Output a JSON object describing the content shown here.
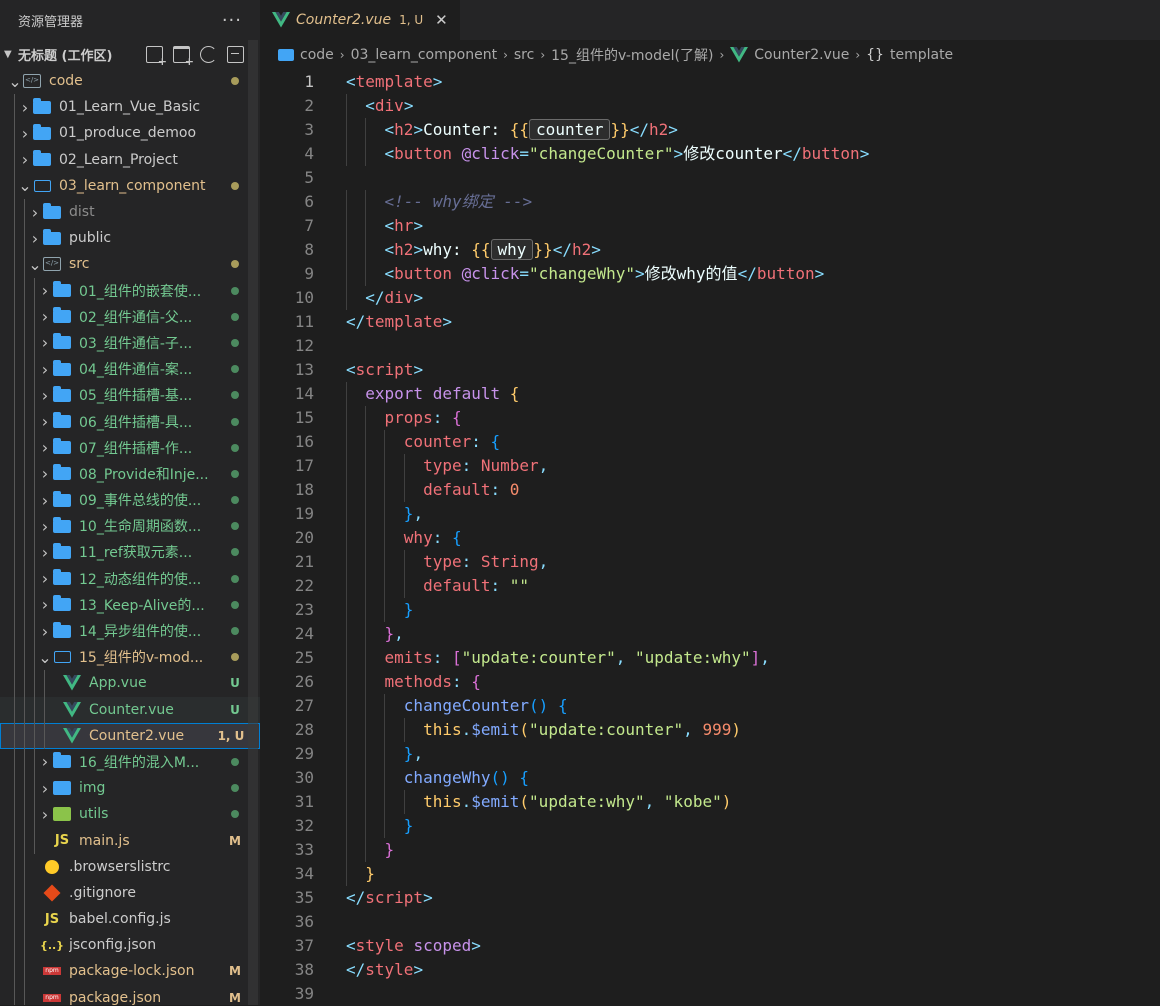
{
  "sidebar": {
    "title": "资源管理器",
    "more": "···",
    "workspace": "无标题 (工作区)",
    "tree": [
      {
        "depth": 0,
        "chev": "down",
        "icon": "folder-src",
        "label": "code",
        "color": "#e2c08d",
        "dot": "#a89c5b"
      },
      {
        "depth": 1,
        "chev": "right",
        "icon": "folder",
        "label": "01_Learn_Vue_Basic",
        "color": "#cccccc"
      },
      {
        "depth": 1,
        "chev": "right",
        "icon": "folder",
        "label": "01_produce_demoo",
        "color": "#cccccc"
      },
      {
        "depth": 1,
        "chev": "right",
        "icon": "folder",
        "label": "02_Learn_Project",
        "color": "#cccccc"
      },
      {
        "depth": 1,
        "chev": "down",
        "icon": "folder-open",
        "label": "03_learn_component",
        "color": "#e2c08d",
        "dot": "#a89c5b"
      },
      {
        "depth": 2,
        "chev": "right",
        "icon": "folder",
        "label": "dist",
        "color": "#8c8c8c"
      },
      {
        "depth": 2,
        "chev": "right",
        "icon": "folder",
        "label": "public",
        "color": "#cccccc"
      },
      {
        "depth": 2,
        "chev": "down",
        "icon": "folder-src",
        "label": "src",
        "color": "#e2c08d",
        "dot": "#a89c5b"
      },
      {
        "depth": 3,
        "chev": "right",
        "icon": "folder",
        "label": "01_组件的嵌套使...",
        "color": "#73c991",
        "dot": "#4c8a5f"
      },
      {
        "depth": 3,
        "chev": "right",
        "icon": "folder",
        "label": "02_组件通信-父...",
        "color": "#73c991",
        "dot": "#4c8a5f"
      },
      {
        "depth": 3,
        "chev": "right",
        "icon": "folder",
        "label": "03_组件通信-子...",
        "color": "#73c991",
        "dot": "#4c8a5f"
      },
      {
        "depth": 3,
        "chev": "right",
        "icon": "folder",
        "label": "04_组件通信-案...",
        "color": "#73c991",
        "dot": "#4c8a5f"
      },
      {
        "depth": 3,
        "chev": "right",
        "icon": "folder",
        "label": "05_组件插槽-基...",
        "color": "#73c991",
        "dot": "#4c8a5f"
      },
      {
        "depth": 3,
        "chev": "right",
        "icon": "folder",
        "label": "06_组件插槽-具...",
        "color": "#73c991",
        "dot": "#4c8a5f"
      },
      {
        "depth": 3,
        "chev": "right",
        "icon": "folder",
        "label": "07_组件插槽-作...",
        "color": "#73c991",
        "dot": "#4c8a5f"
      },
      {
        "depth": 3,
        "chev": "right",
        "icon": "folder",
        "label": "08_Provide和Inje...",
        "color": "#73c991",
        "dot": "#4c8a5f"
      },
      {
        "depth": 3,
        "chev": "right",
        "icon": "folder",
        "label": "09_事件总线的使...",
        "color": "#73c991",
        "dot": "#4c8a5f"
      },
      {
        "depth": 3,
        "chev": "right",
        "icon": "folder",
        "label": "10_生命周期函数...",
        "color": "#73c991",
        "dot": "#4c8a5f"
      },
      {
        "depth": 3,
        "chev": "right",
        "icon": "folder",
        "label": "11_ref获取元素...",
        "color": "#73c991",
        "dot": "#4c8a5f"
      },
      {
        "depth": 3,
        "chev": "right",
        "icon": "folder",
        "label": "12_动态组件的使...",
        "color": "#73c991",
        "dot": "#4c8a5f"
      },
      {
        "depth": 3,
        "chev": "right",
        "icon": "folder",
        "label": "13_Keep-Alive的...",
        "color": "#73c991",
        "dot": "#4c8a5f"
      },
      {
        "depth": 3,
        "chev": "right",
        "icon": "folder",
        "label": "14_异步组件的使...",
        "color": "#73c991",
        "dot": "#4c8a5f"
      },
      {
        "depth": 3,
        "chev": "down",
        "icon": "folder-open",
        "label": "15_组件的v-mod...",
        "color": "#e2c08d",
        "dot": "#a89c5b"
      },
      {
        "depth": 4,
        "chev": "",
        "icon": "vue",
        "label": "App.vue",
        "color": "#73c991",
        "badge": "U",
        "badgeColor": "#73c991"
      },
      {
        "depth": 4,
        "chev": "",
        "icon": "vue",
        "label": "Counter.vue",
        "color": "#73c991",
        "badge": "U",
        "badgeColor": "#73c991",
        "state": "hover"
      },
      {
        "depth": 4,
        "chev": "",
        "icon": "vue",
        "label": "Counter2.vue",
        "color": "#e2c08d",
        "badge": "1, U",
        "badgeColor": "#e2c08d",
        "state": "selected"
      },
      {
        "depth": 3,
        "chev": "right",
        "icon": "folder",
        "label": "16_组件的混入M...",
        "color": "#73c991",
        "dot": "#4c8a5f"
      },
      {
        "depth": 3,
        "chev": "right",
        "icon": "img",
        "label": "img",
        "color": "#73c991",
        "dot": "#4c8a5f"
      },
      {
        "depth": 3,
        "chev": "right",
        "icon": "utils",
        "label": "utils",
        "color": "#73c991",
        "dot": "#4c8a5f"
      },
      {
        "depth": 3,
        "chev": "",
        "icon": "js",
        "label": "main.js",
        "color": "#e2c08d",
        "badge": "M",
        "badgeColor": "#e2c08d"
      },
      {
        "depth": 2,
        "chev": "",
        "icon": "browsers",
        "label": ".browserslistrc",
        "color": "#cccccc"
      },
      {
        "depth": 2,
        "chev": "",
        "icon": "git",
        "label": ".gitignore",
        "color": "#cccccc"
      },
      {
        "depth": 2,
        "chev": "",
        "icon": "js",
        "label": "babel.config.js",
        "color": "#cccccc"
      },
      {
        "depth": 2,
        "chev": "",
        "icon": "json",
        "label": "jsconfig.json",
        "color": "#cccccc"
      },
      {
        "depth": 2,
        "chev": "",
        "icon": "npm",
        "label": "package-lock.json",
        "color": "#e2c08d",
        "badge": "M",
        "badgeColor": "#e2c08d"
      },
      {
        "depth": 2,
        "chev": "",
        "icon": "npm",
        "label": "package.json",
        "color": "#e2c08d",
        "badge": "M",
        "badgeColor": "#e2c08d"
      }
    ]
  },
  "editor": {
    "tab": {
      "label": "Counter2.vue",
      "badge": "1, U",
      "close": "✕"
    },
    "breadcrumb": [
      "code",
      "03_learn_component",
      "src",
      "15_组件的v-model(了解)",
      "Counter2.vue",
      "template"
    ],
    "active_line": 1
  },
  "code_lines": [
    [
      [
        "c-punc",
        "<"
      ],
      [
        "c-tag",
        "template"
      ],
      [
        "c-punc",
        ">"
      ]
    ],
    [
      [
        "",
        "  "
      ],
      [
        "c-punc",
        "<"
      ],
      [
        "c-tag",
        "div"
      ],
      [
        "c-punc",
        ">"
      ]
    ],
    [
      [
        "",
        "    "
      ],
      [
        "c-punc",
        "<"
      ],
      [
        "c-tag",
        "h2"
      ],
      [
        "c-punc",
        ">"
      ],
      [
        "c-plain",
        "Counter: "
      ],
      [
        "c-mustache",
        "{{"
      ],
      [
        "box",
        "counter"
      ],
      [
        "c-mustache",
        "}}"
      ],
      [
        "c-punc",
        "</"
      ],
      [
        "c-tag",
        "h2"
      ],
      [
        "c-punc",
        ">"
      ]
    ],
    [
      [
        "",
        "    "
      ],
      [
        "c-punc",
        "<"
      ],
      [
        "c-tag",
        "button"
      ],
      [
        "c-plain",
        " "
      ],
      [
        "c-attr",
        "@click"
      ],
      [
        "c-punc",
        "="
      ],
      [
        "c-str",
        "\"changeCounter\""
      ],
      [
        "c-punc",
        ">"
      ],
      [
        "c-plain",
        "修改counter"
      ],
      [
        "c-punc",
        "</"
      ],
      [
        "c-tag",
        "button"
      ],
      [
        "c-punc",
        ">"
      ]
    ],
    [],
    [
      [
        "",
        "    "
      ],
      [
        "c-comment",
        "<!-- why绑定 -->"
      ]
    ],
    [
      [
        "",
        "    "
      ],
      [
        "c-punc",
        "<"
      ],
      [
        "c-tag",
        "hr"
      ],
      [
        "c-punc",
        ">"
      ]
    ],
    [
      [
        "",
        "    "
      ],
      [
        "c-punc",
        "<"
      ],
      [
        "c-tag",
        "h2"
      ],
      [
        "c-punc",
        ">"
      ],
      [
        "c-plain",
        "why: "
      ],
      [
        "c-mustache",
        "{{"
      ],
      [
        "box",
        "why"
      ],
      [
        "c-mustache",
        "}}"
      ],
      [
        "c-punc",
        "</"
      ],
      [
        "c-tag",
        "h2"
      ],
      [
        "c-punc",
        ">"
      ]
    ],
    [
      [
        "",
        "    "
      ],
      [
        "c-punc",
        "<"
      ],
      [
        "c-tag",
        "button"
      ],
      [
        "c-plain",
        " "
      ],
      [
        "c-attr",
        "@click"
      ],
      [
        "c-punc",
        "="
      ],
      [
        "c-str",
        "\"changeWhy\""
      ],
      [
        "c-punc",
        ">"
      ],
      [
        "c-plain",
        "修改why的值"
      ],
      [
        "c-punc",
        "</"
      ],
      [
        "c-tag",
        "button"
      ],
      [
        "c-punc",
        ">"
      ]
    ],
    [
      [
        "",
        "  "
      ],
      [
        "c-punc",
        "</"
      ],
      [
        "c-tag",
        "div"
      ],
      [
        "c-punc",
        ">"
      ]
    ],
    [
      [
        "c-punc",
        "</"
      ],
      [
        "c-tag",
        "template"
      ],
      [
        "c-punc",
        ">"
      ]
    ],
    [],
    [
      [
        "c-punc",
        "<"
      ],
      [
        "c-tag",
        "script"
      ],
      [
        "c-punc",
        ">"
      ]
    ],
    [
      [
        "",
        "  "
      ],
      [
        "c-kw",
        "export"
      ],
      [
        "c-plain",
        " "
      ],
      [
        "c-kw",
        "default"
      ],
      [
        "c-plain",
        " "
      ],
      [
        "c-brace",
        "{"
      ]
    ],
    [
      [
        "",
        "    "
      ],
      [
        "c-key",
        "props"
      ],
      [
        "c-punc",
        ":"
      ],
      [
        "c-plain",
        " "
      ],
      [
        "c-brace2",
        "{"
      ]
    ],
    [
      [
        "",
        "      "
      ],
      [
        "c-key",
        "counter"
      ],
      [
        "c-punc",
        ":"
      ],
      [
        "c-plain",
        " "
      ],
      [
        "c-brace3",
        "{"
      ]
    ],
    [
      [
        "",
        "        "
      ],
      [
        "c-key",
        "type"
      ],
      [
        "c-punc",
        ":"
      ],
      [
        "c-plain",
        " "
      ],
      [
        "c-key",
        "Number"
      ],
      [
        "c-punc",
        ","
      ]
    ],
    [
      [
        "",
        "        "
      ],
      [
        "c-key",
        "default"
      ],
      [
        "c-punc",
        ":"
      ],
      [
        "c-plain",
        " "
      ],
      [
        "c-num",
        "0"
      ]
    ],
    [
      [
        "",
        "      "
      ],
      [
        "c-brace3",
        "}"
      ],
      [
        "c-punc",
        ","
      ]
    ],
    [
      [
        "",
        "      "
      ],
      [
        "c-key",
        "why"
      ],
      [
        "c-punc",
        ":"
      ],
      [
        "c-plain",
        " "
      ],
      [
        "c-brace3",
        "{"
      ]
    ],
    [
      [
        "",
        "        "
      ],
      [
        "c-key",
        "type"
      ],
      [
        "c-punc",
        ":"
      ],
      [
        "c-plain",
        " "
      ],
      [
        "c-key",
        "String"
      ],
      [
        "c-punc",
        ","
      ]
    ],
    [
      [
        "",
        "        "
      ],
      [
        "c-key",
        "default"
      ],
      [
        "c-punc",
        ":"
      ],
      [
        "c-plain",
        " "
      ],
      [
        "c-str",
        "\"\""
      ]
    ],
    [
      [
        "",
        "      "
      ],
      [
        "c-brace3",
        "}"
      ]
    ],
    [
      [
        "",
        "    "
      ],
      [
        "c-brace2",
        "}"
      ],
      [
        "c-punc",
        ","
      ]
    ],
    [
      [
        "",
        "    "
      ],
      [
        "c-key",
        "emits"
      ],
      [
        "c-punc",
        ":"
      ],
      [
        "c-plain",
        " "
      ],
      [
        "c-brace2",
        "["
      ],
      [
        "c-str",
        "\"update:counter\""
      ],
      [
        "c-punc",
        ","
      ],
      [
        "c-plain",
        " "
      ],
      [
        "c-str",
        "\"update:why\""
      ],
      [
        "c-brace2",
        "]"
      ],
      [
        "c-punc",
        ","
      ]
    ],
    [
      [
        "",
        "    "
      ],
      [
        "c-key",
        "methods"
      ],
      [
        "c-punc",
        ":"
      ],
      [
        "c-plain",
        " "
      ],
      [
        "c-brace2",
        "{"
      ]
    ],
    [
      [
        "",
        "      "
      ],
      [
        "c-fn",
        "changeCounter"
      ],
      [
        "c-brace3",
        "()"
      ],
      [
        "c-plain",
        " "
      ],
      [
        "c-brace3",
        "{"
      ]
    ],
    [
      [
        "",
        "        "
      ],
      [
        "c-this",
        "this"
      ],
      [
        "c-punc",
        "."
      ],
      [
        "c-fn",
        "$emit"
      ],
      [
        "c-brace",
        "("
      ],
      [
        "c-str",
        "\"update:counter\""
      ],
      [
        "c-punc",
        ","
      ],
      [
        "c-plain",
        " "
      ],
      [
        "c-num",
        "999"
      ],
      [
        "c-brace",
        ")"
      ]
    ],
    [
      [
        "",
        "      "
      ],
      [
        "c-brace3",
        "}"
      ],
      [
        "c-punc",
        ","
      ]
    ],
    [
      [
        "",
        "      "
      ],
      [
        "c-fn",
        "changeWhy"
      ],
      [
        "c-brace3",
        "()"
      ],
      [
        "c-plain",
        " "
      ],
      [
        "c-brace3",
        "{"
      ]
    ],
    [
      [
        "",
        "        "
      ],
      [
        "c-this",
        "this"
      ],
      [
        "c-punc",
        "."
      ],
      [
        "c-fn",
        "$emit"
      ],
      [
        "c-brace",
        "("
      ],
      [
        "c-str",
        "\"update:why\""
      ],
      [
        "c-punc",
        ","
      ],
      [
        "c-plain",
        " "
      ],
      [
        "c-str",
        "\"kobe\""
      ],
      [
        "c-brace",
        ")"
      ]
    ],
    [
      [
        "",
        "      "
      ],
      [
        "c-brace3",
        "}"
      ]
    ],
    [
      [
        "",
        "    "
      ],
      [
        "c-brace2",
        "}"
      ]
    ],
    [
      [
        "",
        "  "
      ],
      [
        "c-brace",
        "}"
      ]
    ],
    [
      [
        "c-punc",
        "</"
      ],
      [
        "c-tag",
        "script"
      ],
      [
        "c-punc",
        ">"
      ]
    ],
    [],
    [
      [
        "c-punc",
        "<"
      ],
      [
        "c-tag",
        "style"
      ],
      [
        "c-plain",
        " "
      ],
      [
        "c-attr",
        "scoped"
      ],
      [
        "c-punc",
        ">"
      ]
    ],
    [
      [
        "c-punc",
        "</"
      ],
      [
        "c-tag",
        "style"
      ],
      [
        "c-punc",
        ">"
      ]
    ],
    []
  ]
}
